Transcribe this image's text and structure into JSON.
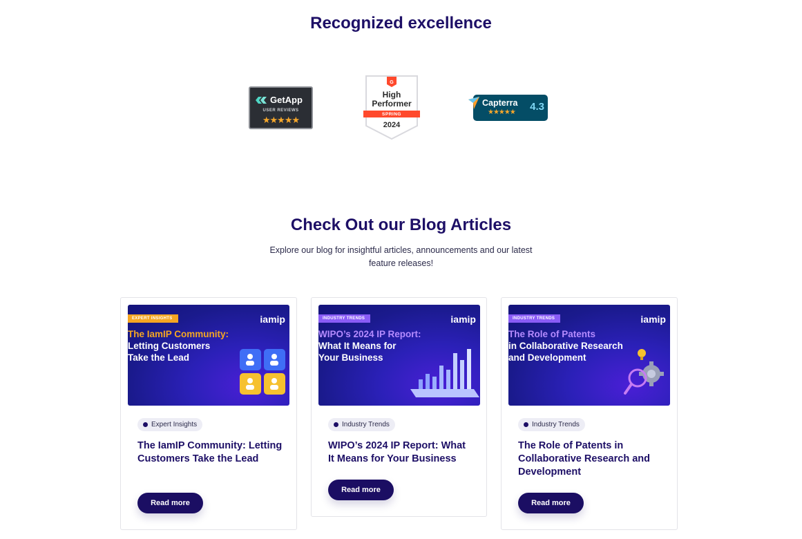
{
  "excellence": {
    "title": "Recognized excellence"
  },
  "badges": {
    "getapp": {
      "name": "GetApp",
      "subtitle": "USER REVIEWS",
      "stars": "★★★★★"
    },
    "g2": {
      "line1": "High",
      "line2": "Performer",
      "season": "SPRING",
      "year": "2024"
    },
    "capterra": {
      "name": "Capterra",
      "stars": "★★★★★",
      "score": "4.3"
    }
  },
  "blog": {
    "title": "Check Out our Blog Articles",
    "subtitle": "Explore our blog for insightful articles, announcements and our latest feature releases!"
  },
  "cards": [
    {
      "image_tag": "EXPERT INSIGHTS",
      "image_logo": "iamip",
      "image_headline": [
        "The IamIP Community:",
        "Letting Customers",
        "Take the Lead"
      ],
      "category": "Expert Insights",
      "title": "The IamIP Community: Letting Customers Take the Lead",
      "button": "Read more"
    },
    {
      "image_tag": "INDUSTRY TRENDS",
      "image_logo": "iamip",
      "image_headline": [
        "WIPO’s 2024 IP Report:",
        "What It Means for",
        "Your Business"
      ],
      "category": "Industry Trends",
      "title": "WIPO’s 2024 IP Report: What It Means for Your Business",
      "button": "Read more"
    },
    {
      "image_tag": "INDUSTRY TRENDS",
      "image_logo": "iamip",
      "image_headline": [
        "The Role of Patents",
        "in Collaborative Research",
        "and Development"
      ],
      "category": "Industry Trends",
      "title": "The Role of Patents in Collaborative Research and Development",
      "button": "Read more"
    }
  ],
  "colors": {
    "heading": "#1d0f66",
    "button": "#1b0e63",
    "accent_orange": "#f5a623",
    "capterra_bg": "#044d66",
    "g2_red": "#ff492c"
  }
}
